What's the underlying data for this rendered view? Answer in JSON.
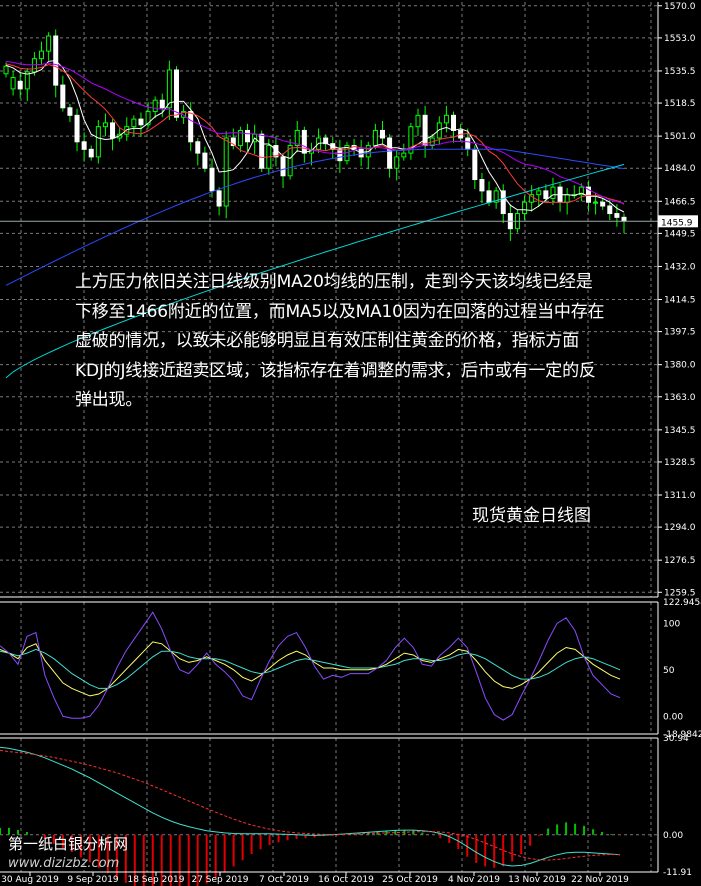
{
  "chart_data": [
    {
      "type": "candlestick",
      "panel": "main",
      "ylim": [
        1257.0,
        1572.0
      ],
      "yticks": [
        "1570.0",
        "1553.0",
        "1535.5",
        "1518.5",
        "1501.0",
        "1484.0",
        "1466.5",
        "1449.5",
        "1432.0",
        "1414.5",
        "1397.5",
        "1380.0",
        "1363.0",
        "1345.5",
        "1328.5",
        "1311.0",
        "1294.0",
        "1276.5",
        "1259.5"
      ],
      "current_price": "1455.9",
      "grid": true,
      "candles": {
        "close": [
          1538,
          1532,
          1526,
          1535,
          1542,
          1546,
          1554,
          1528,
          1516,
          1512,
          1498,
          1494,
          1490,
          1506,
          1508,
          1500,
          1502,
          1506,
          1510,
          1507,
          1514,
          1520,
          1516,
          1536,
          1511,
          1514,
          1498,
          1492,
          1484,
          1472,
          1464,
          1500,
          1496,
          1504,
          1498,
          1502,
          1484,
          1496,
          1490,
          1480,
          1496,
          1504,
          1492,
          1494,
          1500,
          1497,
          1494,
          1488,
          1496,
          1494,
          1490,
          1496,
          1504,
          1500,
          1484,
          1490,
          1492,
          1506,
          1512,
          1496,
          1500,
          1508,
          1512,
          1504,
          1500,
          1494,
          1478,
          1472,
          1466,
          1472,
          1460,
          1452,
          1460,
          1466,
          1470,
          1472,
          1468,
          1474,
          1466,
          1470,
          1470,
          1474,
          1466,
          1466,
          1464,
          1460,
          1458,
          1456
        ],
        "delta": [
          4,
          6,
          -4,
          9,
          7,
          4,
          8,
          -26,
          -12,
          -4,
          -14,
          -4,
          -4,
          16,
          2,
          -8,
          2,
          4,
          4,
          -3,
          7,
          6,
          -4,
          20,
          -25,
          3,
          -16,
          -6,
          -8,
          -12,
          -8,
          36,
          -4,
          8,
          -6,
          4,
          -18,
          12,
          -6,
          -10,
          16,
          8,
          -12,
          2,
          6,
          -3,
          -3,
          -6,
          8,
          -2,
          -4,
          6,
          8,
          -4,
          -16,
          6,
          2,
          14,
          6,
          -16,
          4,
          8,
          4,
          -8,
          -4,
          -6,
          -16,
          -6,
          -6,
          6,
          -12,
          -8,
          8,
          6,
          4,
          2,
          -4,
          6,
          -8,
          4,
          0,
          4,
          -8,
          0,
          -2,
          -4,
          -2,
          -2
        ]
      },
      "series": [
        {
          "name": "MA5",
          "color": "#ffffff"
        },
        {
          "name": "MA10",
          "color": "#ff3b3b"
        },
        {
          "name": "MA20",
          "color": "#b000ff"
        },
        {
          "name": "MA60",
          "color": "#2a4bff"
        },
        {
          "name": "MA120",
          "color": "#00d8d8"
        }
      ],
      "x_tick_labels": [
        "30 Aug 2019",
        "9 Sep 2019",
        "18 Sep 2019",
        "27 Sep 2019",
        "7 Oct 2019",
        "16 Oct 2019",
        "25 Oct 2019",
        "4 Nov 2019",
        "13 Nov 2019",
        "22 Nov 2019"
      ],
      "annotation_text": "上方压力依旧关注日线级别MA20均线的压制，走到今天该均线已经是下移至1466附近的位置，而MA5以及MA10因为在回落的过程当中存在虚破的情况，以致未必能够明显且有效压制住黄金的价格，指标方面KDJ的J线接近超卖区域，该指标存在着调整的需求，后市或有一定的反弹出现。",
      "caption": "现货黄金日线图"
    },
    {
      "type": "line",
      "panel": "kdj",
      "ylim": [
        -18.9842,
        122.9454
      ],
      "yticks": [
        "122.9454",
        "100",
        "50",
        "0.00",
        "-18.9842"
      ],
      "k": [
        72,
        68,
        62,
        74,
        78,
        60,
        48,
        36,
        30,
        26,
        22,
        24,
        30,
        40,
        50,
        60,
        70,
        80,
        78,
        70,
        62,
        58,
        60,
        64,
        60,
        56,
        50,
        42,
        38,
        44,
        52,
        60,
        66,
        70,
        66,
        58,
        52,
        52,
        50,
        50,
        50,
        50,
        52,
        56,
        62,
        68,
        66,
        60,
        58,
        62,
        66,
        72,
        70,
        60,
        48,
        38,
        32,
        30,
        34,
        40,
        48,
        58,
        68,
        74,
        72,
        64,
        56,
        50,
        44,
        40
      ],
      "d": [
        70,
        68,
        65,
        68,
        72,
        68,
        62,
        54,
        46,
        40,
        34,
        30,
        30,
        34,
        40,
        48,
        56,
        64,
        70,
        70,
        68,
        64,
        62,
        62,
        62,
        60,
        56,
        52,
        48,
        46,
        48,
        52,
        56,
        60,
        62,
        60,
        58,
        56,
        54,
        52,
        52,
        52,
        52,
        54,
        56,
        60,
        62,
        62,
        60,
        60,
        62,
        66,
        68,
        66,
        62,
        56,
        50,
        44,
        40,
        40,
        42,
        46,
        52,
        58,
        62,
        64,
        62,
        58,
        54,
        50
      ],
      "j": [
        76,
        68,
        56,
        86,
        90,
        44,
        20,
        0,
        -2,
        -2,
        0,
        12,
        30,
        52,
        70,
        84,
        98,
        112,
        94,
        70,
        50,
        46,
        56,
        68,
        56,
        48,
        38,
        22,
        18,
        40,
        60,
        76,
        86,
        90,
        74,
        54,
        40,
        44,
        42,
        46,
        46,
        46,
        52,
        60,
        74,
        84,
        74,
        56,
        54,
        66,
        74,
        84,
        74,
        48,
        20,
        2,
        -4,
        2,
        22,
        40,
        60,
        82,
        100,
        106,
        92,
        64,
        44,
        34,
        24,
        20
      ]
    },
    {
      "type": "bar+line",
      "panel": "macd",
      "ylim": [
        -11.91,
        30.94
      ],
      "yticks": [
        "30.94",
        "0.00",
        "-11.91"
      ],
      "main": [
        28,
        27.6,
        27,
        26.4,
        25.6,
        24.6,
        23.4,
        22.2,
        21,
        19.6,
        18.2,
        16.6,
        15,
        13.4,
        11.8,
        10.2,
        8.6,
        7,
        5.6,
        4.4,
        3.4,
        2.6,
        1.9,
        1.3,
        0.9,
        0.6,
        0.4,
        0.3,
        0.3,
        0.3,
        0.3,
        0.2,
        0.1,
        0,
        -0.1,
        -0.2,
        -0.1,
        0,
        0.2,
        0.4,
        0.6,
        0.8,
        1,
        1.2,
        1.4,
        1.5,
        1.5,
        1.3,
        1,
        0.4,
        -0.6,
        -2,
        -3.8,
        -5.6,
        -7.2,
        -8.6,
        -9.6,
        -10,
        -9.8,
        -9.2,
        -8.2,
        -7.2,
        -6.4,
        -5.8,
        -5.6,
        -5.6,
        -5.8,
        -6,
        -6.2,
        -6.4
      ],
      "signal": [
        27,
        26.6,
        26.3,
        26,
        25.6,
        25.2,
        24.7,
        24.1,
        23.5,
        22.9,
        22.2,
        21.4,
        20.6,
        19.8,
        18.8,
        17.8,
        16.8,
        15.6,
        14.4,
        13.2,
        12,
        10.8,
        9.6,
        8.4,
        7.2,
        6.1,
        5,
        4,
        3.1,
        2.4,
        1.8,
        1.3,
        0.9,
        0.6,
        0.4,
        0.2,
        0.1,
        0.1,
        0.1,
        0.2,
        0.3,
        0.4,
        0.5,
        0.6,
        0.7,
        0.8,
        0.9,
        1,
        1,
        0.9,
        0.6,
        0.1,
        -0.6,
        -1.5,
        -2.6,
        -3.8,
        -5,
        -6.1,
        -7,
        -7.6,
        -8,
        -8.1,
        -7.9,
        -7.6,
        -7.2,
        -6.9,
        -6.6,
        -6.4,
        -6.3,
        -6.3
      ]
    }
  ],
  "watermark": {
    "name": "第一纸白银分析网",
    "url": "www.dizizbz.com"
  }
}
